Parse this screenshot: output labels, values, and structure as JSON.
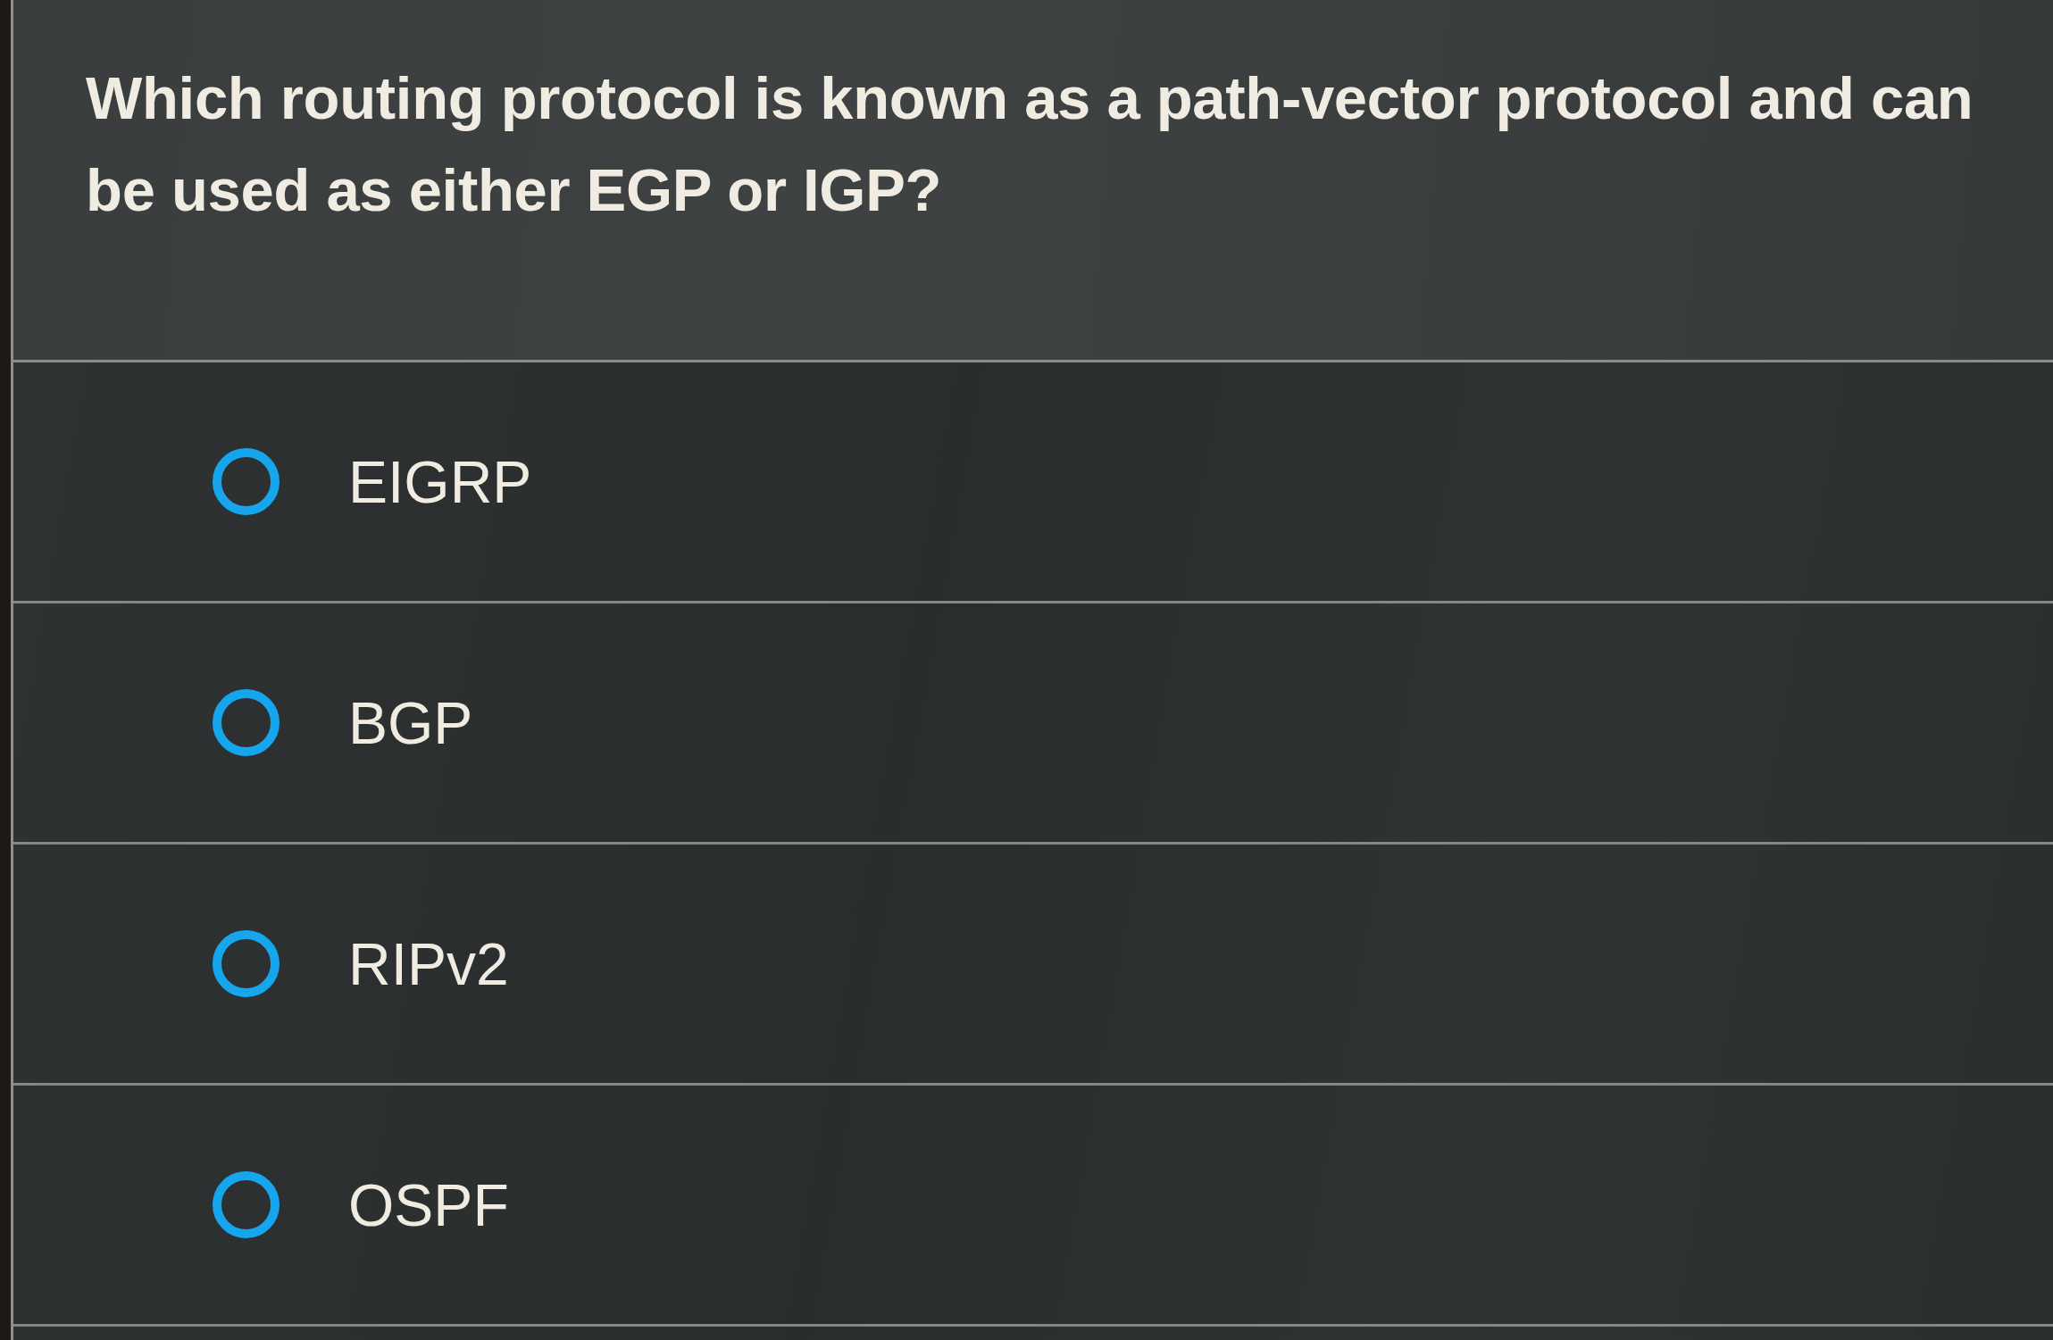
{
  "question": {
    "text": "Which routing protocol is known as a path-vector protocol and can be used as either EGP or IGP?"
  },
  "options": [
    {
      "label": "EIGRP",
      "selected": false
    },
    {
      "label": "BGP",
      "selected": false
    },
    {
      "label": "RIPv2",
      "selected": false
    },
    {
      "label": "OSPF",
      "selected": false
    }
  ]
}
